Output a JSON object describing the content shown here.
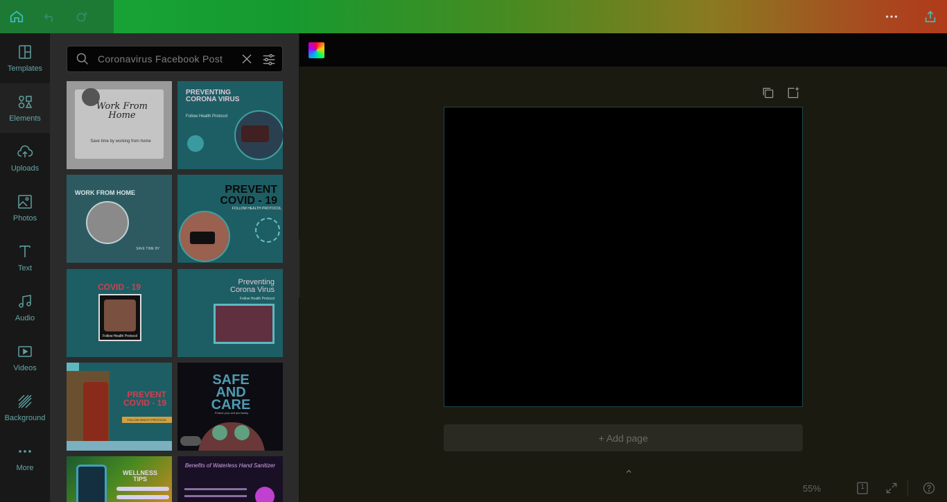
{
  "rail": {
    "items": [
      {
        "label": "Templates"
      },
      {
        "label": "Elements"
      },
      {
        "label": "Uploads"
      },
      {
        "label": "Photos"
      },
      {
        "label": "Text"
      },
      {
        "label": "Audio"
      },
      {
        "label": "Videos"
      },
      {
        "label": "Background"
      },
      {
        "label": "More"
      }
    ]
  },
  "search": {
    "value": "Coronavirus Facebook Post"
  },
  "templates": [
    {
      "title": "Work From Home",
      "sub": "Save time by working from home"
    },
    {
      "title": "PREVENTING CORONA VIRUS",
      "sub": "Follow Health Protocol"
    },
    {
      "title": "WORK FROM HOME",
      "sub": "SAVE TIME BY"
    },
    {
      "title": "PREVENT COVID - 19",
      "sub": "FOLLOW HEALTH PROTOCOL"
    },
    {
      "title": "COVID - 19",
      "sub": "Follow Health Protocol"
    },
    {
      "title": "Preventing Corona Virus",
      "sub": "Follow Health Protocol"
    },
    {
      "title": "PREVENT COVID - 19",
      "sub": "FOLLOW HEALTH PROTOCOL"
    },
    {
      "title": "SAFE AND CARE",
      "sub": "Protect your self and family"
    },
    {
      "title": "WELLNESS TIPS",
      "sub": ""
    },
    {
      "title": "Benefits of Waterless Hand Sanitizer",
      "sub": ""
    }
  ],
  "editor": {
    "add_page": "+ Add page",
    "zoom": "55%",
    "page_number": "1"
  }
}
